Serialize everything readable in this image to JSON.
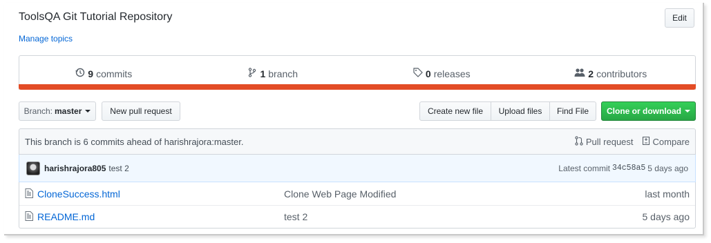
{
  "repo": {
    "description": "ToolsQA Git Tutorial Repository",
    "manage_topics": "Manage topics",
    "edit_label": "Edit"
  },
  "summary": {
    "commits_count": "9",
    "commits_label": "commits",
    "branches_count": "1",
    "branches_label": "branch",
    "releases_count": "0",
    "releases_label": "releases",
    "contributors_count": "2",
    "contributors_label": "contributors",
    "language_color": "#e34c26"
  },
  "toolbar": {
    "branch_label": "Branch:",
    "branch_value": "master",
    "new_pull_request": "New pull request",
    "create_new_file": "Create new file",
    "upload_files": "Upload files",
    "find_file": "Find File",
    "clone_or_download": "Clone or download"
  },
  "branch_info": {
    "text": "This branch is 6 commits ahead of harishrajora:master.",
    "pull_request": "Pull request",
    "compare": "Compare"
  },
  "latest_commit": {
    "author": "harishrajora805",
    "message": "test 2",
    "label": "Latest commit",
    "sha": "34c58a5",
    "age": "5 days ago"
  },
  "files": [
    {
      "icon": "file-icon",
      "name": "CloneSuccess.html",
      "message": "Clone Web Page Modified",
      "age": "last month"
    },
    {
      "icon": "file-icon",
      "name": "README.md",
      "message": "test 2",
      "age": "5 days ago"
    }
  ]
}
